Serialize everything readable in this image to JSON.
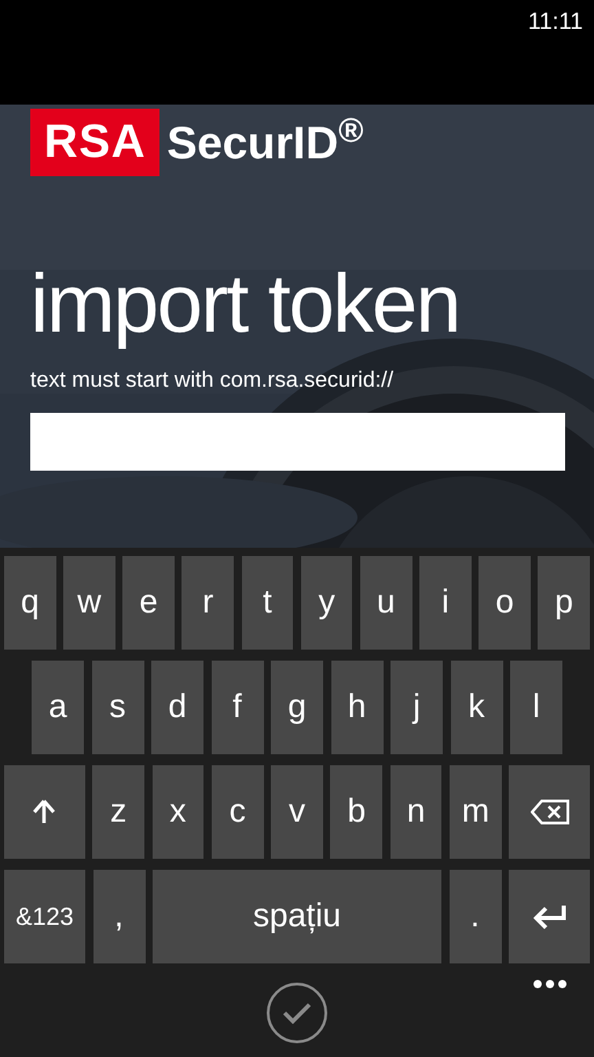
{
  "status_bar": {
    "time": "11:11"
  },
  "logo": {
    "mark": "RSA",
    "wordmark": "SecurID$^{®}$"
  },
  "title": "import token",
  "hint": "text must start with com.rsa.securid://",
  "keyboard": {
    "rows": [
      {
        "keys": [
          {
            "kind": "char",
            "label": "q"
          },
          {
            "kind": "char",
            "label": "w"
          },
          {
            "kind": "char",
            "label": "e"
          },
          {
            "kind": "char",
            "label": "r"
          },
          {
            "kind": "char",
            "label": "t"
          },
          {
            "kind": "char",
            "label": "y"
          },
          {
            "kind": "char",
            "label": "u"
          },
          {
            "kind": "char",
            "label": "i"
          },
          {
            "kind": "char",
            "label": "o"
          },
          {
            "kind": "char",
            "label": "p"
          }
        ]
      },
      {
        "keys": [
          {
            "kind": "char",
            "label": "a"
          },
          {
            "kind": "char",
            "label": "s"
          },
          {
            "kind": "char",
            "label": "d"
          },
          {
            "kind": "char",
            "label": "f"
          },
          {
            "kind": "char",
            "label": "g"
          },
          {
            "kind": "char",
            "label": "h"
          },
          {
            "kind": "char",
            "label": "j"
          },
          {
            "kind": "char",
            "label": "k"
          },
          {
            "kind": "char",
            "label": "l"
          }
        ]
      },
      {
        "keys": [
          {
            "kind": "shift"
          },
          {
            "kind": "char",
            "label": "z"
          },
          {
            "kind": "char",
            "label": "x"
          },
          {
            "kind": "char",
            "label": "c"
          },
          {
            "kind": "char",
            "label": "v"
          },
          {
            "kind": "char",
            "label": "b"
          },
          {
            "kind": "char",
            "label": "n"
          },
          {
            "kind": "char",
            "label": "m"
          },
          {
            "kind": "backspace"
          }
        ]
      },
      {
        "keys": [
          {
            "kind": "symbols",
            "label": "&123"
          },
          {
            "kind": "char",
            "label": ","
          },
          {
            "kind": "space",
            "label": "spațiu"
          },
          {
            "kind": "char",
            "label": "."
          },
          {
            "kind": "enter"
          }
        ]
      }
    ]
  }
}
